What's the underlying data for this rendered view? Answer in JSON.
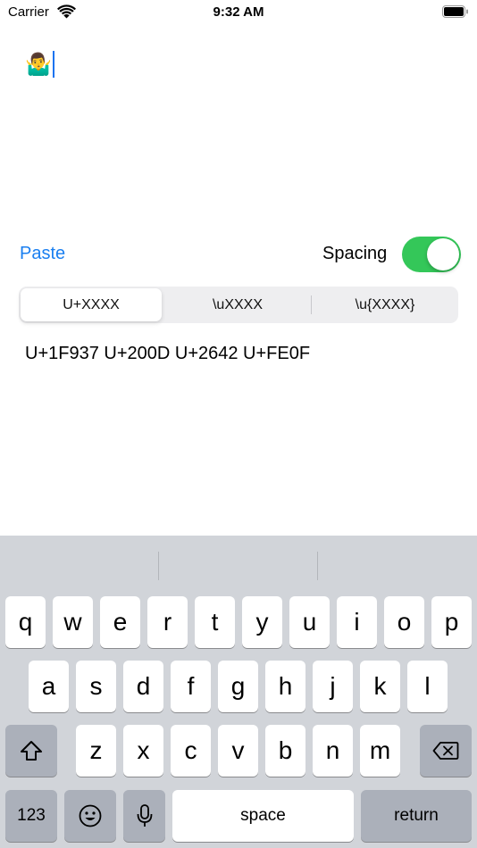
{
  "status_bar": {
    "carrier": "Carrier",
    "time": "9:32 AM"
  },
  "text_area": {
    "value": "🤷‍♂️"
  },
  "controls": {
    "paste_label": "Paste",
    "spacing_label": "Spacing",
    "spacing_on": true,
    "toggle_color": "#34c759"
  },
  "segmented": {
    "options": [
      "U+XXXX",
      "\\uXXXX",
      "\\u{XXXX}"
    ],
    "selected_index": 0
  },
  "output": {
    "text": "U+1F937 U+200D U+2642 U+FE0F"
  },
  "keyboard": {
    "row1": [
      "q",
      "w",
      "e",
      "r",
      "t",
      "y",
      "u",
      "i",
      "o",
      "p"
    ],
    "row2": [
      "a",
      "s",
      "d",
      "f",
      "g",
      "h",
      "j",
      "k",
      "l"
    ],
    "row3": [
      "z",
      "x",
      "c",
      "v",
      "b",
      "n",
      "m"
    ],
    "numbers_label": "123",
    "space_label": "space",
    "return_label": "return",
    "shift_icon": "shift-icon",
    "delete_icon": "delete-icon",
    "emoji_icon": "emoji-icon",
    "mic_icon": "microphone-icon"
  }
}
